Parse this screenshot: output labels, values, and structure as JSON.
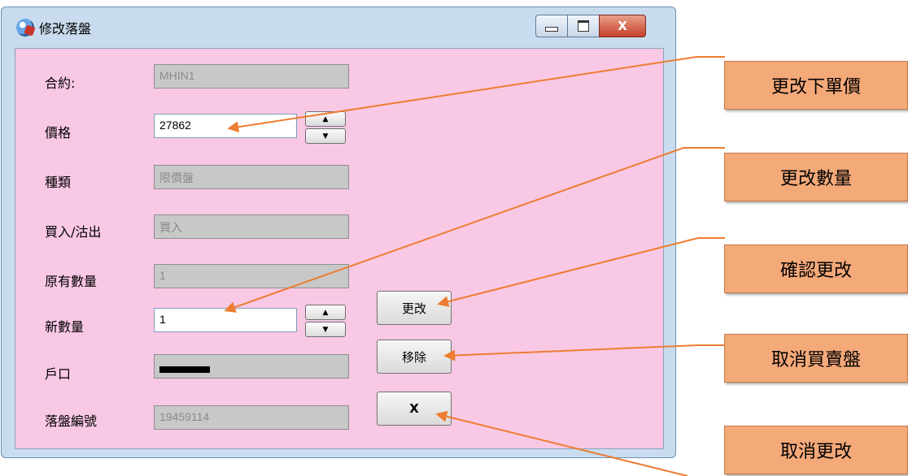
{
  "window": {
    "title": "修改落盤",
    "close_glyph": "X"
  },
  "form": {
    "contract": {
      "label": "合約:",
      "value": "MHIN1"
    },
    "price": {
      "label": "價格",
      "value": "27862",
      "up_glyph": "▲",
      "down_glyph": "▼"
    },
    "type": {
      "label": "種類",
      "value": "限價盤"
    },
    "side": {
      "label": "買入/沽出",
      "value": "買入"
    },
    "orig_qty": {
      "label": "原有數量",
      "value": "1"
    },
    "new_qty": {
      "label": "新數量",
      "value": "1",
      "up_glyph": "▲",
      "down_glyph": "▼"
    },
    "account": {
      "label": "戶口"
    },
    "order_no": {
      "label": "落盤編號",
      "value": "19459114"
    }
  },
  "buttons": {
    "modify": "更改",
    "remove": "移除",
    "cancel": "X"
  },
  "callouts": [
    "更改下單價",
    "更改數量",
    "確認更改",
    "取消買賣盤",
    "取消更改"
  ],
  "colors": {
    "form_background": "#f9c8e5",
    "callout_fill": "#f4a979",
    "arrow": "#ed7d31"
  }
}
